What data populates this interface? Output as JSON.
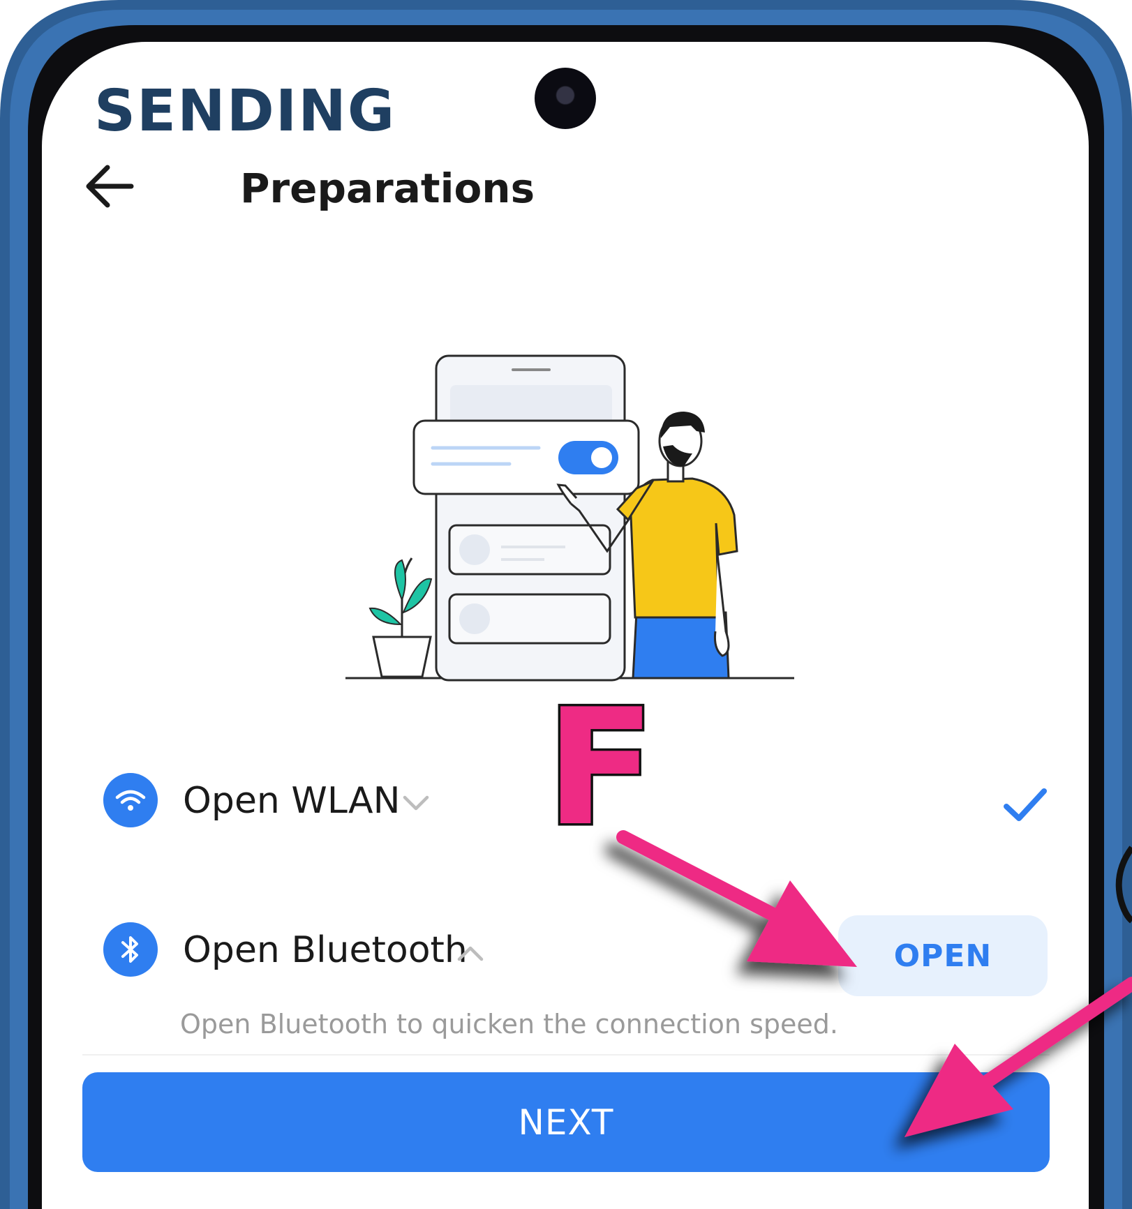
{
  "header": {
    "section_title": "SENDING",
    "nav_title": "Preparations"
  },
  "items": [
    {
      "label": "Open WLAN",
      "expanded": false,
      "done": true,
      "icon": "wifi-icon"
    },
    {
      "label": "Open Bluetooth",
      "expanded": true,
      "done": false,
      "icon": "bluetooth-icon",
      "description": "Open Bluetooth to quicken the connection speed.",
      "action_label": "OPEN"
    }
  ],
  "footer": {
    "next_label": "NEXT"
  },
  "annotation": {
    "letter": "F"
  },
  "colors": {
    "accent": "#2f7ef0",
    "accent_light": "#e7f1fd",
    "title": "#1f3f61",
    "frame": "#2e5f95",
    "annotation": "#ee2b84"
  }
}
